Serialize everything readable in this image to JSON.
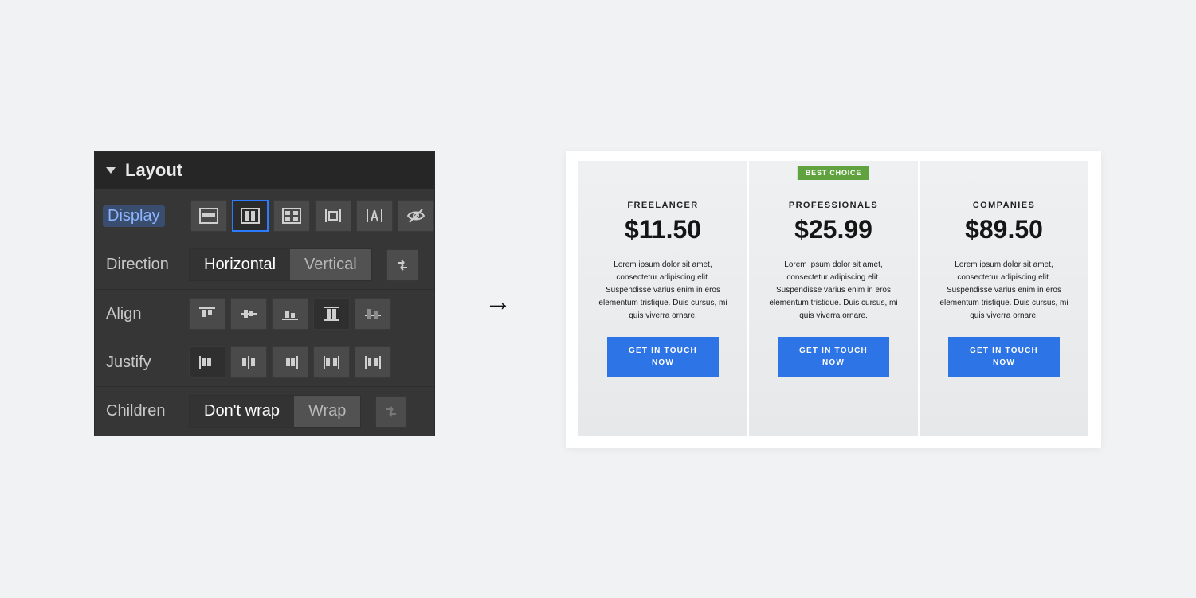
{
  "panel": {
    "title": "Layout",
    "display": {
      "label": "Display",
      "options": [
        "block",
        "flex",
        "grid",
        "inline-block",
        "inline",
        "none"
      ],
      "selected_index": 1
    },
    "direction": {
      "label": "Direction",
      "horizontal": "Horizontal",
      "vertical": "Vertical",
      "selected": "horizontal"
    },
    "align": {
      "label": "Align",
      "options": [
        "start",
        "center",
        "end",
        "stretch",
        "baseline"
      ],
      "selected_index": 3
    },
    "justify": {
      "label": "Justify",
      "options": [
        "start",
        "center",
        "end",
        "space-between",
        "space-around"
      ],
      "selected_index": 0
    },
    "children": {
      "label": "Children",
      "dont_wrap": "Don't wrap",
      "wrap": "Wrap",
      "selected": "dont_wrap"
    }
  },
  "arrow": "→",
  "preview": {
    "badge": "BEST CHOICE",
    "cards": [
      {
        "tier": "FREELANCER",
        "price": "$11.50",
        "desc": "Lorem ipsum dolor sit amet, consectetur adipiscing elit. Suspendisse varius enim in eros elementum tristique. Duis cursus, mi quis viverra ornare.",
        "cta": "GET IN TOUCH NOW",
        "badge": false
      },
      {
        "tier": "PROFESSIONALS",
        "price": "$25.99",
        "desc": "Lorem ipsum dolor sit amet, consectetur adipiscing elit. Suspendisse varius enim in eros elementum tristique. Duis cursus, mi quis viverra ornare.",
        "cta": "GET IN TOUCH NOW",
        "badge": true
      },
      {
        "tier": "COMPANIES",
        "price": "$89.50",
        "desc": "Lorem ipsum dolor sit amet, consectetur adipiscing elit. Suspendisse varius enim in eros elementum tristique. Duis cursus, mi quis viverra ornare.",
        "cta": "GET IN TOUCH NOW",
        "badge": false
      }
    ]
  }
}
